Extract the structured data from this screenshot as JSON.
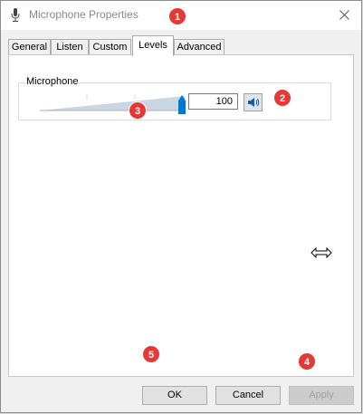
{
  "window": {
    "title": "Microphone Properties",
    "close_icon": "close-icon"
  },
  "tabs": [
    {
      "label": "General"
    },
    {
      "label": "Listen"
    },
    {
      "label": "Custom"
    },
    {
      "label": "Levels",
      "active": true
    },
    {
      "label": "Advanced"
    }
  ],
  "levels": {
    "group_label": "Microphone",
    "value": "100",
    "slider_level": 1.0,
    "mute_icon": "speaker-icon"
  },
  "buttons": {
    "ok": "OK",
    "cancel": "Cancel",
    "apply": "Apply"
  },
  "badges": [
    "1",
    "2",
    "3",
    "4",
    "5"
  ],
  "colors": {
    "accent": "#0078d7",
    "badge": "#e53935"
  }
}
